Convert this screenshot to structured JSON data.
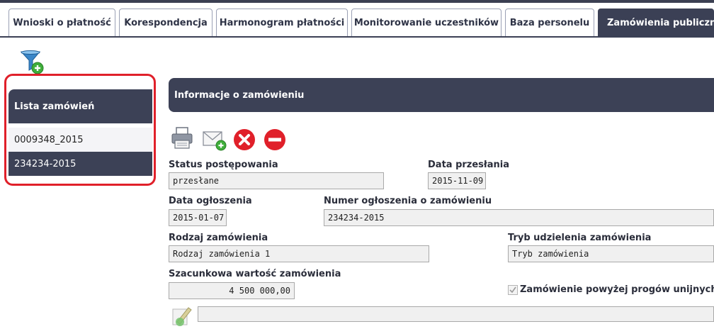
{
  "tabs": [
    {
      "label": "Wnioski o płatność"
    },
    {
      "label": "Korespondencja"
    },
    {
      "label": "Harmonogram płatności"
    },
    {
      "label": "Monitorowanie uczestników"
    },
    {
      "label": "Baza personelu"
    },
    {
      "label": "Zamówienia publiczne",
      "active": true
    }
  ],
  "toolbar": {
    "filter_icon": "filter-add-icon"
  },
  "sidebar": {
    "title": "Lista zamówień",
    "items": [
      {
        "label": "0009348_2015"
      },
      {
        "label": "234234-2015",
        "selected": true
      }
    ]
  },
  "main": {
    "title": "Informacje o zamówieniu",
    "actions": [
      "print-icon",
      "mail-add-icon",
      "delete-icon",
      "remove-icon"
    ],
    "fields": {
      "status_label": "Status postępowania",
      "status_value": "przesłane",
      "date_sent_label": "Data przesłania",
      "date_sent_value": "2015-11-09",
      "date_announced_label": "Data ogłoszenia",
      "date_announced_value": "2015-01-07",
      "announcement_no_label": "Numer ogłoszenia o zamówieniu",
      "announcement_no_value": "234234-2015",
      "order_type_label": "Rodzaj zamówienia",
      "order_type_value": "Rodzaj zamówienia 1",
      "procedure_label": "Tryb udzielenia zamówienia",
      "procedure_value": "Tryb zamówienia",
      "estimated_value_label": "Szacunkowa wartość zamówienia",
      "estimated_value": "4 500 000,00",
      "eu_threshold_label": "Zamówienie powyżej progów unijnych",
      "eu_threshold_checked": true
    }
  },
  "colors": {
    "header_bg": "#3c4156",
    "highlight_outline": "#e0202a",
    "delete_red": "#e0202a"
  }
}
